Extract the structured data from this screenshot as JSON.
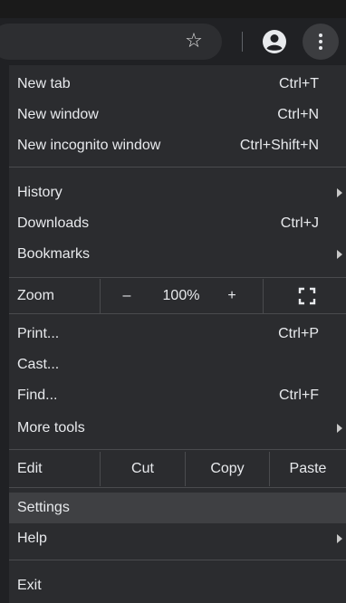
{
  "toolbar": {
    "star_icon": "star-outline-icon",
    "avatar_icon": "account-circle-icon",
    "menu_icon": "three-dot-menu-icon"
  },
  "menu": {
    "new_tab": {
      "label": "New tab",
      "shortcut": "Ctrl+T"
    },
    "new_window": {
      "label": "New window",
      "shortcut": "Ctrl+N"
    },
    "new_incognito": {
      "label": "New incognito window",
      "shortcut": "Ctrl+Shift+N"
    },
    "history": {
      "label": "History"
    },
    "downloads": {
      "label": "Downloads",
      "shortcut": "Ctrl+J"
    },
    "bookmarks": {
      "label": "Bookmarks"
    },
    "zoom": {
      "label": "Zoom",
      "minus": "–",
      "value": "100%",
      "plus": "+",
      "fullscreen_icon": "fullscreen-icon"
    },
    "print": {
      "label": "Print...",
      "shortcut": "Ctrl+P"
    },
    "cast": {
      "label": "Cast..."
    },
    "find": {
      "label": "Find...",
      "shortcut": "Ctrl+F"
    },
    "more_tools": {
      "label": "More tools"
    },
    "edit": {
      "label": "Edit",
      "cut": "Cut",
      "copy": "Copy",
      "paste": "Paste"
    },
    "settings": {
      "label": "Settings"
    },
    "help": {
      "label": "Help"
    },
    "exit": {
      "label": "Exit"
    }
  },
  "colors": {
    "menu_bg": "#2b2c2f",
    "text": "#e8eaed",
    "selected_bg": "#3f4043",
    "separator": "#4a4b4e"
  }
}
